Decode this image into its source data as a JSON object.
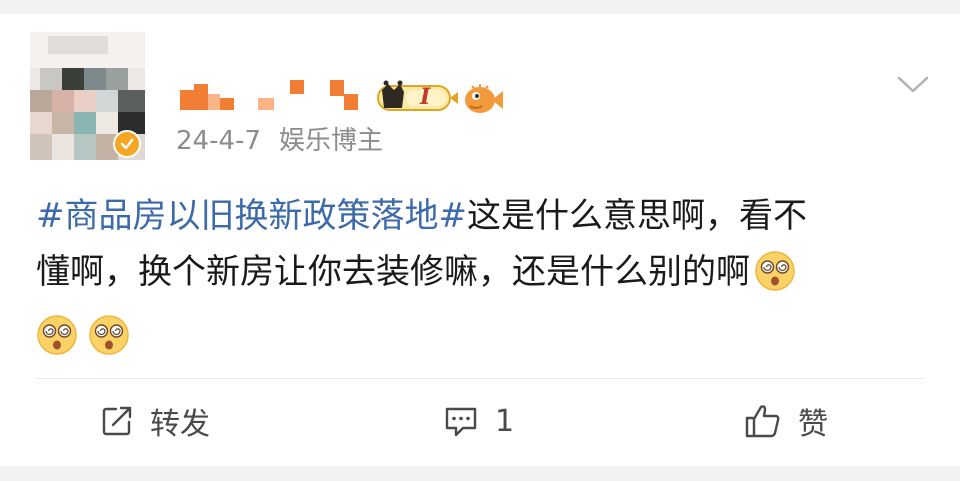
{
  "post": {
    "hashtag": "#商品房以旧换新政策落地#",
    "body_line1_rest": "这是什么意思啊，看不",
    "body_line2": "懂啊，换个新房让你去装修嘛，还是什么别的啊"
  },
  "author": {
    "date": "24-4-7",
    "source": "娱乐博主",
    "level_label": "I"
  },
  "actions": {
    "repost_label": "转发",
    "comment_count": "1",
    "like_label": "赞"
  },
  "colors": {
    "hashtag": "#3d6aa8",
    "verified": "#f5a623",
    "name_mosaic": "#f27d35"
  },
  "icons": {
    "verified": "verified-check-icon",
    "level": "level-badge-icon",
    "fan": "fish-badge-icon",
    "more": "chevron-down-icon",
    "repost": "repost-icon",
    "comment": "comment-icon",
    "like": "thumbs-up-icon",
    "emoji": "dizzy-face-emoji"
  }
}
